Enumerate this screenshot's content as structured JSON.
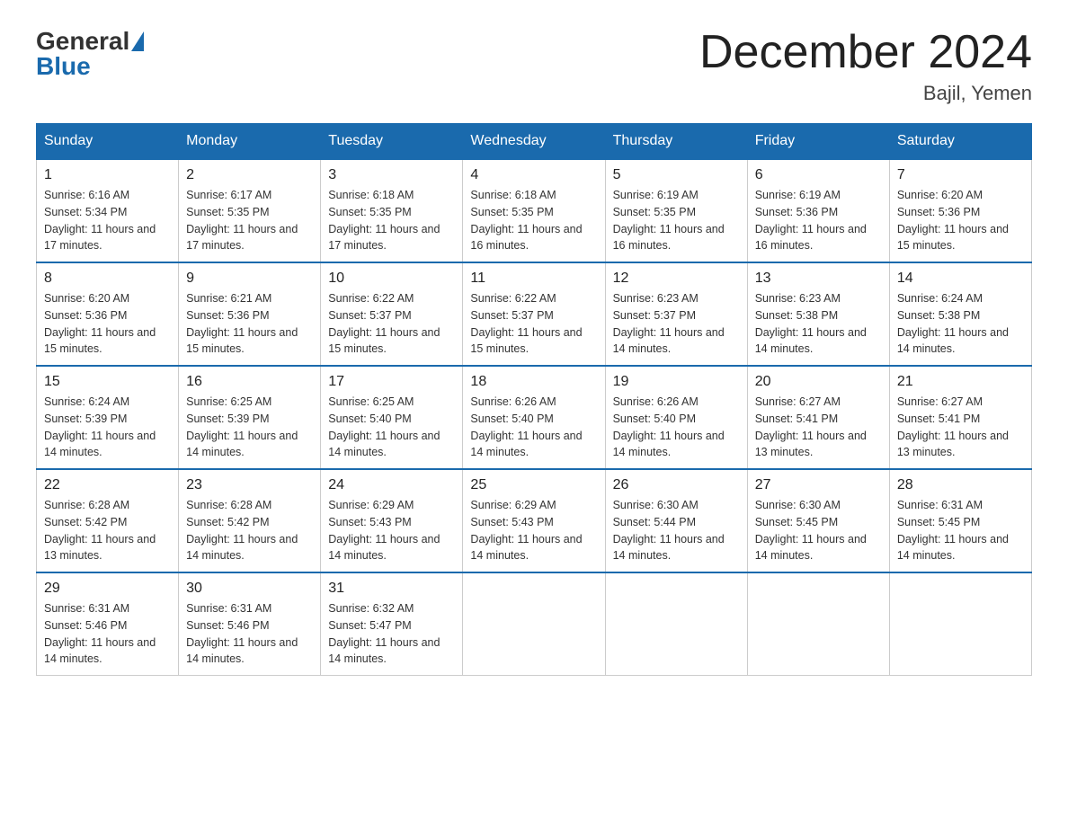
{
  "header": {
    "logo_general": "General",
    "logo_blue": "Blue",
    "month_title": "December 2024",
    "location": "Bajil, Yemen"
  },
  "weekdays": [
    "Sunday",
    "Monday",
    "Tuesday",
    "Wednesday",
    "Thursday",
    "Friday",
    "Saturday"
  ],
  "weeks": [
    [
      {
        "day": "1",
        "sunrise": "6:16 AM",
        "sunset": "5:34 PM",
        "daylight": "11 hours and 17 minutes."
      },
      {
        "day": "2",
        "sunrise": "6:17 AM",
        "sunset": "5:35 PM",
        "daylight": "11 hours and 17 minutes."
      },
      {
        "day": "3",
        "sunrise": "6:18 AM",
        "sunset": "5:35 PM",
        "daylight": "11 hours and 17 minutes."
      },
      {
        "day": "4",
        "sunrise": "6:18 AM",
        "sunset": "5:35 PM",
        "daylight": "11 hours and 16 minutes."
      },
      {
        "day": "5",
        "sunrise": "6:19 AM",
        "sunset": "5:35 PM",
        "daylight": "11 hours and 16 minutes."
      },
      {
        "day": "6",
        "sunrise": "6:19 AM",
        "sunset": "5:36 PM",
        "daylight": "11 hours and 16 minutes."
      },
      {
        "day": "7",
        "sunrise": "6:20 AM",
        "sunset": "5:36 PM",
        "daylight": "11 hours and 15 minutes."
      }
    ],
    [
      {
        "day": "8",
        "sunrise": "6:20 AM",
        "sunset": "5:36 PM",
        "daylight": "11 hours and 15 minutes."
      },
      {
        "day": "9",
        "sunrise": "6:21 AM",
        "sunset": "5:36 PM",
        "daylight": "11 hours and 15 minutes."
      },
      {
        "day": "10",
        "sunrise": "6:22 AM",
        "sunset": "5:37 PM",
        "daylight": "11 hours and 15 minutes."
      },
      {
        "day": "11",
        "sunrise": "6:22 AM",
        "sunset": "5:37 PM",
        "daylight": "11 hours and 15 minutes."
      },
      {
        "day": "12",
        "sunrise": "6:23 AM",
        "sunset": "5:37 PM",
        "daylight": "11 hours and 14 minutes."
      },
      {
        "day": "13",
        "sunrise": "6:23 AM",
        "sunset": "5:38 PM",
        "daylight": "11 hours and 14 minutes."
      },
      {
        "day": "14",
        "sunrise": "6:24 AM",
        "sunset": "5:38 PM",
        "daylight": "11 hours and 14 minutes."
      }
    ],
    [
      {
        "day": "15",
        "sunrise": "6:24 AM",
        "sunset": "5:39 PM",
        "daylight": "11 hours and 14 minutes."
      },
      {
        "day": "16",
        "sunrise": "6:25 AM",
        "sunset": "5:39 PM",
        "daylight": "11 hours and 14 minutes."
      },
      {
        "day": "17",
        "sunrise": "6:25 AM",
        "sunset": "5:40 PM",
        "daylight": "11 hours and 14 minutes."
      },
      {
        "day": "18",
        "sunrise": "6:26 AM",
        "sunset": "5:40 PM",
        "daylight": "11 hours and 14 minutes."
      },
      {
        "day": "19",
        "sunrise": "6:26 AM",
        "sunset": "5:40 PM",
        "daylight": "11 hours and 14 minutes."
      },
      {
        "day": "20",
        "sunrise": "6:27 AM",
        "sunset": "5:41 PM",
        "daylight": "11 hours and 13 minutes."
      },
      {
        "day": "21",
        "sunrise": "6:27 AM",
        "sunset": "5:41 PM",
        "daylight": "11 hours and 13 minutes."
      }
    ],
    [
      {
        "day": "22",
        "sunrise": "6:28 AM",
        "sunset": "5:42 PM",
        "daylight": "11 hours and 13 minutes."
      },
      {
        "day": "23",
        "sunrise": "6:28 AM",
        "sunset": "5:42 PM",
        "daylight": "11 hours and 14 minutes."
      },
      {
        "day": "24",
        "sunrise": "6:29 AM",
        "sunset": "5:43 PM",
        "daylight": "11 hours and 14 minutes."
      },
      {
        "day": "25",
        "sunrise": "6:29 AM",
        "sunset": "5:43 PM",
        "daylight": "11 hours and 14 minutes."
      },
      {
        "day": "26",
        "sunrise": "6:30 AM",
        "sunset": "5:44 PM",
        "daylight": "11 hours and 14 minutes."
      },
      {
        "day": "27",
        "sunrise": "6:30 AM",
        "sunset": "5:45 PM",
        "daylight": "11 hours and 14 minutes."
      },
      {
        "day": "28",
        "sunrise": "6:31 AM",
        "sunset": "5:45 PM",
        "daylight": "11 hours and 14 minutes."
      }
    ],
    [
      {
        "day": "29",
        "sunrise": "6:31 AM",
        "sunset": "5:46 PM",
        "daylight": "11 hours and 14 minutes."
      },
      {
        "day": "30",
        "sunrise": "6:31 AM",
        "sunset": "5:46 PM",
        "daylight": "11 hours and 14 minutes."
      },
      {
        "day": "31",
        "sunrise": "6:32 AM",
        "sunset": "5:47 PM",
        "daylight": "11 hours and 14 minutes."
      },
      null,
      null,
      null,
      null
    ]
  ]
}
